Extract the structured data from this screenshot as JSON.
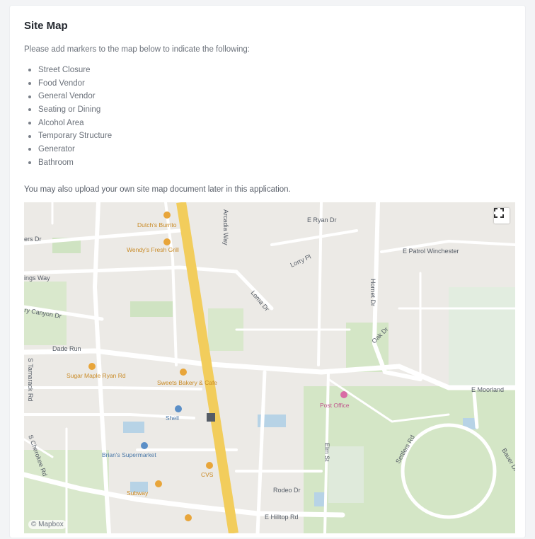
{
  "section": {
    "title": "Site Map",
    "intro": "Please add markers to the map below to indicate the following:",
    "items": [
      "Street Closure",
      "Food Vendor",
      "General Vendor",
      "Seating or Dining",
      "Alcohol Area",
      "Temporary Structure",
      "Generator",
      "Bathroom"
    ],
    "upload_note": "You may also upload your own site map document later in this application."
  },
  "map": {
    "attribution": "© Mapbox",
    "fullscreen_icon": "fullscreen-icon",
    "street_labels": {
      "s1": "ers Dr",
      "s2": "ings Way",
      "s3": "ry Canyon Dr",
      "s4": "Dade Run",
      "s5": "S Tamarack Rd",
      "s6": "S Cherokee Rd",
      "s7": "E Ryan Dr",
      "s8": "E Patrol Winchester",
      "s9": "Lorry Pl",
      "s10": "E Moorland",
      "s11": "Rodeo Dr",
      "s12": "E Hilltop Rd",
      "s13": "Settlers Rd",
      "s14": "Bauer Dr",
      "s15": "Arcadia Way",
      "s16": "Loma Dr",
      "s17": "Hornet Dr",
      "s18": "Oak Dr",
      "s19": "Elm St"
    },
    "poi_labels": {
      "p1": "Dutch's Burrito",
      "p2": "Wendy's Fresh Grill",
      "p3": "Sugar Maple Ryan Rd",
      "p4": "Sweets Bakery & Cafe",
      "p5": "Shell",
      "p6": "Brian's Supermarket",
      "p7": "CVS",
      "p8": "Subway",
      "p9": "Post Office"
    },
    "colors": {
      "land": "#eceae6",
      "road": "#ffffff",
      "highway": "#f2cd5c",
      "park": "#cfe3c2",
      "water": "#b7d3e6",
      "poi_food": "#e8a53a",
      "poi_shop": "#5b8fc7",
      "poi_misc": "#d96ba5"
    }
  }
}
